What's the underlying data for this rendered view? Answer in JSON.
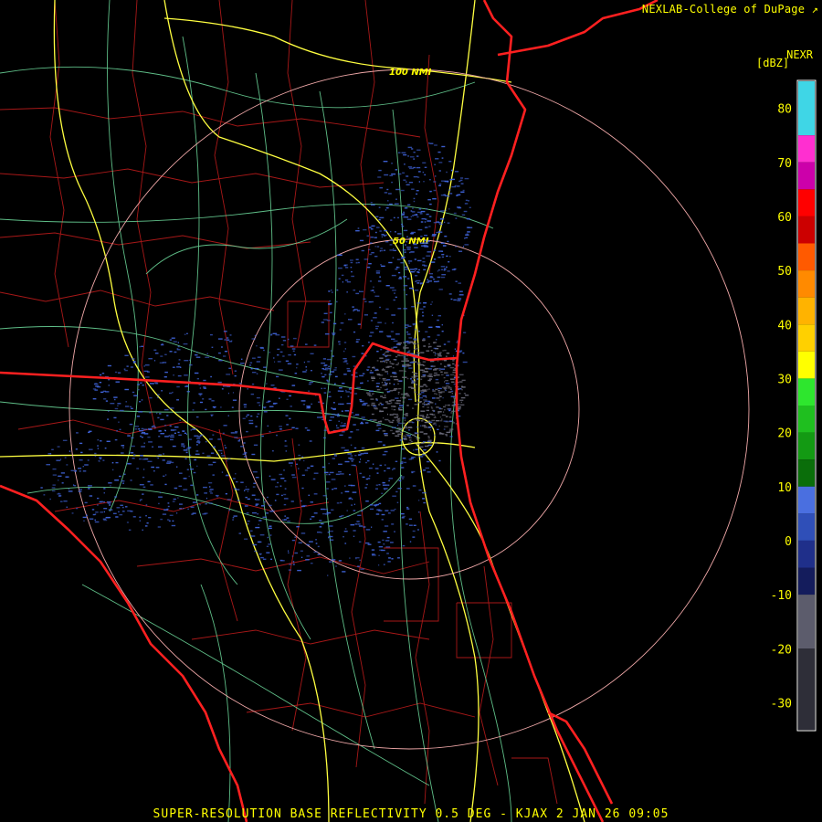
{
  "header": {
    "credit": "NEXLAB-College of DuPage",
    "credit_icon": "link-arrow-icon",
    "product": "NEXR",
    "units": "[dBZ]"
  },
  "caption": "SUPER-RESOLUTION BASE REFLECTIVITY 0.5 DEG - KJAX 2 JAN 26 09:05",
  "range_rings": {
    "inner_label": "50 NMI",
    "outer_label": "100 NMI"
  },
  "color_scale": {
    "labels": [
      "80",
      "70",
      "60",
      "50",
      "40",
      "30",
      "20",
      "10",
      "0",
      "-10",
      "-20",
      "-30"
    ],
    "min": -35,
    "max": 85,
    "bands": [
      {
        "from": 75,
        "to": 85,
        "color": "#3fd6e6"
      },
      {
        "from": 70,
        "to": 75,
        "color": "#ff2fd0"
      },
      {
        "from": 65,
        "to": 70,
        "color": "#cc00aa"
      },
      {
        "from": 60,
        "to": 65,
        "color": "#ff0000"
      },
      {
        "from": 55,
        "to": 60,
        "color": "#cc0000"
      },
      {
        "from": 50,
        "to": 55,
        "color": "#ff5a00"
      },
      {
        "from": 45,
        "to": 50,
        "color": "#ff8a00"
      },
      {
        "from": 40,
        "to": 45,
        "color": "#ffb300"
      },
      {
        "from": 35,
        "to": 40,
        "color": "#ffd000"
      },
      {
        "from": 30,
        "to": 35,
        "color": "#ffff00"
      },
      {
        "from": 25,
        "to": 30,
        "color": "#2ee62e"
      },
      {
        "from": 20,
        "to": 25,
        "color": "#1fbf1f"
      },
      {
        "from": 15,
        "to": 20,
        "color": "#139a13"
      },
      {
        "from": 10,
        "to": 15,
        "color": "#0a6e0a"
      },
      {
        "from": 5,
        "to": 10,
        "color": "#4a6fe0"
      },
      {
        "from": 0,
        "to": 5,
        "color": "#2f4fb8"
      },
      {
        "from": -5,
        "to": 0,
        "color": "#1f2f8a"
      },
      {
        "from": -10,
        "to": -5,
        "color": "#141c5c"
      },
      {
        "from": -20,
        "to": -10,
        "color": "#5c5c6c"
      },
      {
        "from": -35,
        "to": -20,
        "color": "#2e2e38"
      }
    ]
  },
  "colors": {
    "state_border": "#ff2020",
    "county_lines": "#b01010",
    "highways": "#ffff40",
    "roads": "#70e0a0",
    "range_ring": "#f0a8a8",
    "echo_blue": "#3f63d8",
    "echo_gray": "#6a6a7a"
  }
}
